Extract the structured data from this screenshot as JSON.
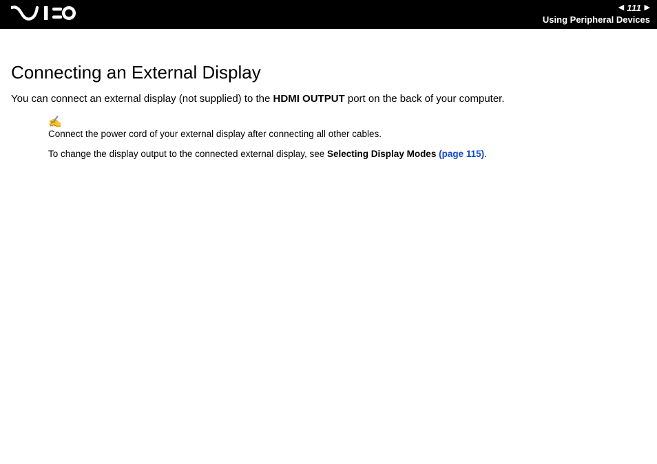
{
  "header": {
    "page_number": "111",
    "section": "Using Peripheral Devices"
  },
  "content": {
    "title": "Connecting an External Display",
    "intro_pre": "You can connect an external display (not supplied) to the ",
    "intro_bold": "HDMI OUTPUT",
    "intro_post": " port on the back of your computer.",
    "note_text": "Connect the power cord of your external display after connecting all other cables.",
    "ref_pre": "To change the display output to the connected external display, see ",
    "ref_bold": "Selecting Display Modes ",
    "ref_link": "(page 115)",
    "ref_post": "."
  }
}
